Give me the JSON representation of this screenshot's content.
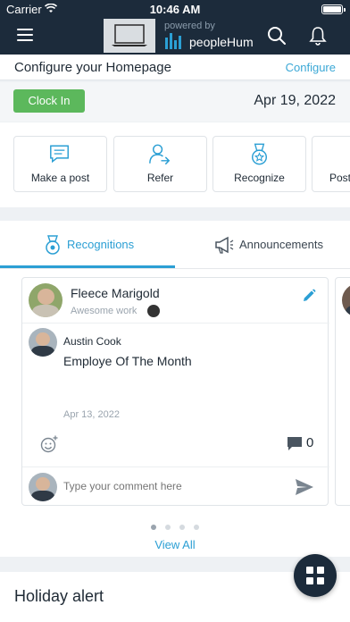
{
  "status_bar": {
    "carrier": "Carrier",
    "time": "10:46 AM"
  },
  "header": {
    "powered_by": "powered by",
    "brand": "peopleHum"
  },
  "configure": {
    "title": "Configure your Homepage",
    "link": "Configure"
  },
  "attendance": {
    "clock_in_label": "Clock In",
    "date": "Apr 19, 2022"
  },
  "quick_actions": [
    {
      "label": "Make a post",
      "icon": "chat-icon"
    },
    {
      "label": "Refer",
      "icon": "refer-user-icon"
    },
    {
      "label": "Recognize",
      "icon": "medal-icon"
    },
    {
      "label": "Post",
      "icon": "post-icon"
    }
  ],
  "tabs": [
    {
      "label": "Recognitions",
      "icon": "medal-icon",
      "active": true
    },
    {
      "label": "Announcements",
      "icon": "megaphone-icon",
      "active": false
    }
  ],
  "post": {
    "recipient_name": "Fleece Marigold",
    "badge": "Awesome work",
    "author_name": "Austin Cook",
    "title": "Employe Of The Month",
    "date": "Apr 13, 2022",
    "comment_count": "0",
    "comment_placeholder": "Type your comment here"
  },
  "pagination": {
    "total": 4,
    "active": 0
  },
  "view_all": "View All",
  "holiday": {
    "title": "Holiday alert"
  },
  "colors": {
    "navy": "#1c2b3b",
    "accent": "#2b9fd4",
    "clock_in": "#5cb85c"
  }
}
